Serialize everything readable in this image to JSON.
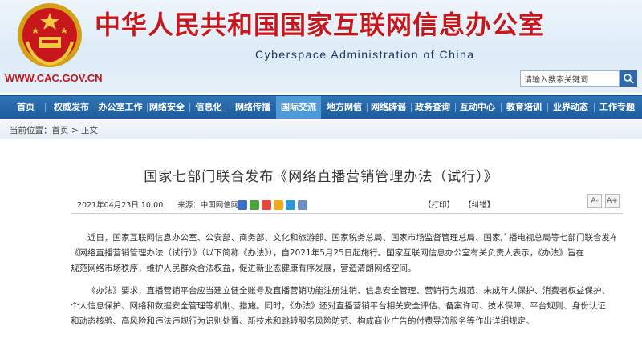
{
  "header": {
    "title": "中华人民共和国国家互联网信息办公室",
    "subtitle": "Cyberspace Administration of China",
    "url": "WWW.CAC.GOV.CN",
    "search_placeholder": "请输入搜索关键词",
    "brand_red": "#c8161d",
    "brand_blue": "#1d5c9c"
  },
  "nav": {
    "items": [
      "首页",
      "权威发布",
      "办公室工作",
      "网络安全",
      "信息化",
      "网络传播",
      "国际交流",
      "地方网信",
      "网络辟谣",
      "政务查询",
      "互动中心",
      "教育培训",
      "业界动态",
      "工作专题"
    ],
    "active": "国际交流"
  },
  "breadcrumb": {
    "label": "当前位置：",
    "home": "首页",
    "sep": " > ",
    "current": "正文"
  },
  "article": {
    "title": "国家七部门联合发布《网络直播营销管理办法（试行）》",
    "date": "2021年04月23日 10:00",
    "source": "来源：中国网信网",
    "print": "【打印】",
    "correction": "【纠错】",
    "font_small": "A-",
    "font_large": "A+",
    "paragraphs": [
      [
        "近日，国家互联网信息办公室、公安部、商务部、文化和旅游部、国家税务总局、国家市场监督管理总局、国家广播电视总局等七部门联合发布",
        "《网络直播营销管理办法（试行）》（以下简称《办法》），自2021年5月25日起施行。国家互联网信息办公室有关负责人表示，《办法》旨在",
        "规范网络市场秩序，维护人民群众合法权益，促进新业态健康有序发展，营造清朗网络空间。"
      ],
      [
        "《办法》要求，直播营销平台应当建立健全账号及直播营销功能注册注销、信息安全管理、营销行为规范、未成年人保护、消费者权益保护、",
        "个人信息保护、网络和数据安全管理等机制、措施。同时，《办法》还对直播营销平台相关安全评估、备案许可、技术保障、平台规则、身份认证",
        "和动态核验、高风险和违法违规行为识别处置、新技术和跳转服务风险防范、构成商业广告的付费导流服务等作出详细规定。"
      ]
    ]
  }
}
